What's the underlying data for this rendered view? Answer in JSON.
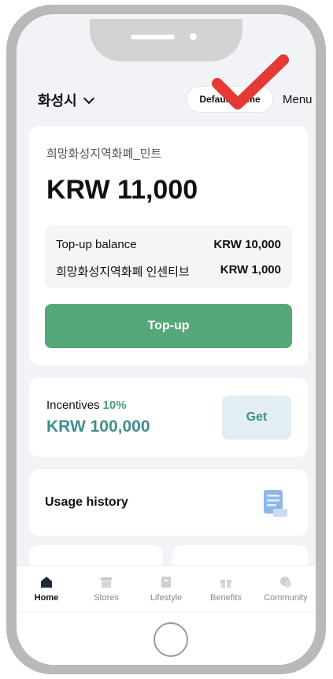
{
  "header": {
    "city_label": "화성시",
    "default_home_label": "Default Home",
    "menu_label": "Menu"
  },
  "wallet": {
    "name": "희망화성지역화폐_민트",
    "amount": "KRW 11,000",
    "rows": [
      {
        "label": "Top-up balance",
        "value": "KRW 10,000"
      },
      {
        "label": "희망화성지역화폐 인센티브",
        "value": "KRW 1,000"
      }
    ],
    "topup_label": "Top-up"
  },
  "incentives": {
    "label": "Incentives",
    "percent": "10%",
    "amount": "KRW 100,000",
    "get_label": "Get"
  },
  "usage": {
    "title": "Usage history"
  },
  "tabs": [
    {
      "label": "Home",
      "icon": "home-icon",
      "active": true
    },
    {
      "label": "Stores",
      "icon": "store-icon",
      "active": false
    },
    {
      "label": "Lifestyle",
      "icon": "lifestyle-icon",
      "active": false
    },
    {
      "label": "Benefits",
      "icon": "gift-icon",
      "active": false
    },
    {
      "label": "Community",
      "icon": "chat-icon",
      "active": false
    }
  ],
  "colors": {
    "primary_green": "#56a777",
    "teal_text": "#3f8f8b",
    "annotation_red": "#e53935",
    "screen_bg": "#f2f3f7"
  }
}
